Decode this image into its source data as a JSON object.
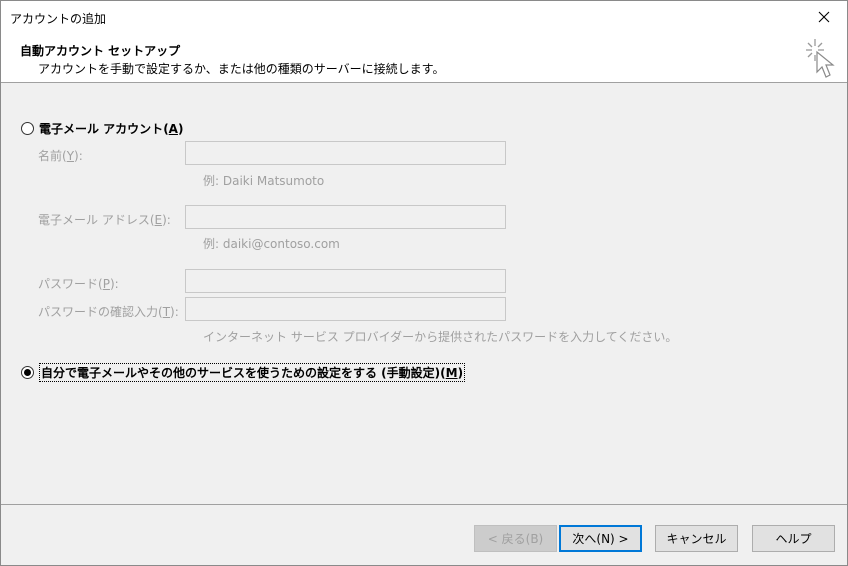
{
  "window": {
    "title": "アカウントの追加",
    "close_glyph": "✕"
  },
  "header": {
    "title": "自動アカウント セットアップ",
    "description": "アカウントを手動で設定するか、または他の種類のサーバーに接続します。",
    "icon": "wizard-cursor-icon"
  },
  "email_account": {
    "option_label": "電子メール アカウント",
    "option_accel": "A",
    "selected": false,
    "name_label": "名前",
    "name_accel": "Y",
    "name_value": "",
    "name_hint": "例: Daiki Matsumoto",
    "email_label": "電子メール アドレス",
    "email_accel": "E",
    "email_value": "",
    "email_hint": "例: daiki@contoso.com",
    "password_label": "パスワード",
    "password_accel": "P",
    "password_value": "",
    "confirm_label": "パスワードの確認入力",
    "confirm_accel": "T",
    "confirm_value": "",
    "password_hint": "インターネット サービス プロバイダーから提供されたパスワードを入力してください。"
  },
  "manual_setup": {
    "option_label": "自分で電子メールやその他のサービスを使うための設定をする (手動設定)",
    "option_accel": "M",
    "selected": true
  },
  "buttons": {
    "back": "< 戻る(B)",
    "next": "次へ(N) >",
    "cancel": "キャンセル",
    "help": "ヘルプ"
  }
}
